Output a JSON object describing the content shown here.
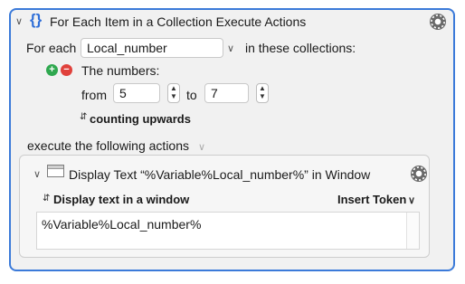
{
  "action": {
    "title": "For Each Item in a Collection Execute Actions",
    "for_each_label": "For each",
    "variable_value": "Local_number",
    "in_collections_label": "in these collections:",
    "collection_name": "The numbers:",
    "from_label": "from",
    "from_value": "5",
    "to_label": "to",
    "to_value": "7",
    "direction": "counting upwards",
    "execute_label": "execute the following actions"
  },
  "sub_action": {
    "title": "Display Text “%Variable%Local_number%” in Window",
    "mode": "Display text in a window",
    "insert_token": "Insert Token",
    "text": "%Variable%Local_number%"
  },
  "icons": {
    "collapse": "chevron-down-icon",
    "braces": "braces-icon",
    "gear": "gear-icon",
    "add": "plus-circle-icon",
    "remove": "minus-circle-icon",
    "updown": "updown-chevron-icon",
    "window": "window-icon"
  },
  "colors": {
    "accent": "#3b7ad9",
    "add": "#2fa84f",
    "remove": "#e0413b"
  }
}
